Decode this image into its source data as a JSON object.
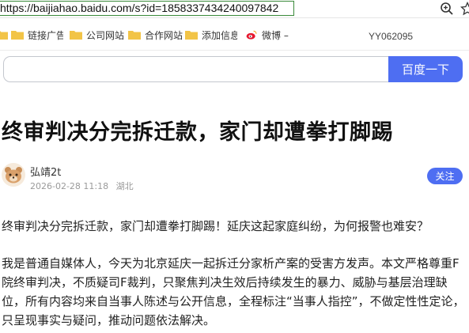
{
  "browser": {
    "url": "https://baijiahao.baidu.com/s?id=1858337434240097842",
    "bookmarks": [
      {
        "label": "",
        "icon": "folder-icon"
      },
      {
        "label": "链接广告",
        "icon": "folder-icon"
      },
      {
        "label": "公司网站",
        "icon": "folder-icon"
      },
      {
        "label": "合作网站",
        "icon": "folder-icon"
      },
      {
        "label": "添加信息",
        "icon": "folder-icon"
      },
      {
        "label": "微博 –",
        "icon": "weibo-icon"
      }
    ],
    "user_code": "YY062095"
  },
  "search": {
    "placeholder": "",
    "button_label": "百度一下"
  },
  "article": {
    "title": "终审判决分完拆迁款，家门却遭拳打脚踢",
    "author": "弘靖2t",
    "date": "2026-02-28 11:18",
    "location": "湖北",
    "follow_label": "关注",
    "paragraphs": [
      "终审判决分完拆迁款，家门却遭拳打脚踢！延庆这起家庭纠纷，为何报警也难安？",
      "我是普通自媒体人，今天为北京延庆一起拆迁分家析产案的受害方发声。本文严格尊重F院终审判决，不质疑司F裁判，只聚焦判决生效后持续发生的暴力、威胁与基层治理缺位，所有内容均来自当事人陈述与公开信息，全程标注“当事人指控”，不做定性性定论，只呈现事实与疑问，推动问题依法解决。"
    ]
  },
  "colors": {
    "accent": "#4e6ef2",
    "folder": "#f2c447"
  }
}
